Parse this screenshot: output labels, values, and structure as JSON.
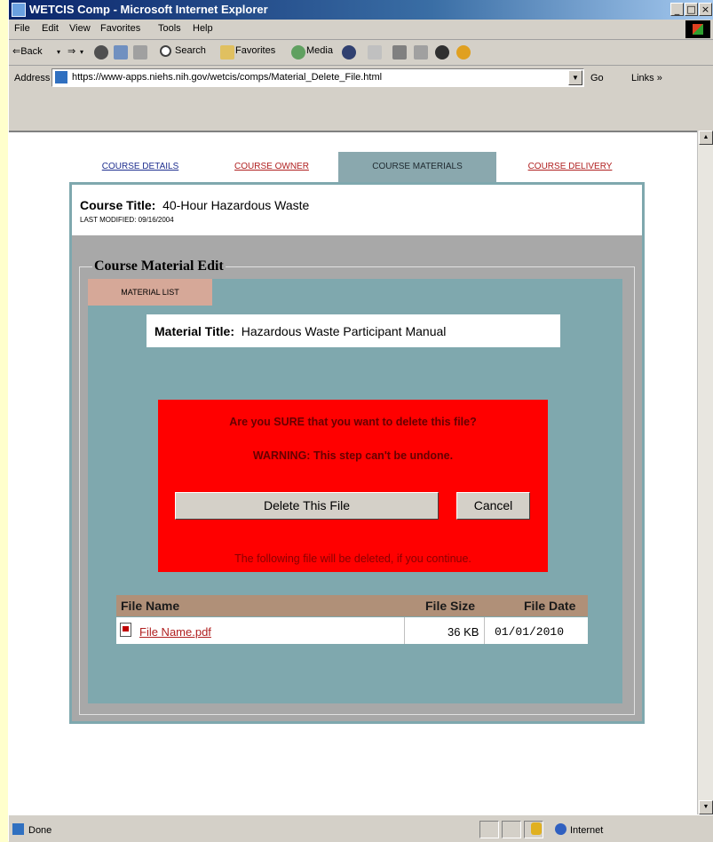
{
  "window": {
    "title": "WETCIS Comp - Microsoft Internet Explorer",
    "minimize": "_",
    "maximize": "□",
    "close": "×"
  },
  "menu": [
    "File",
    "Edit",
    "View",
    "Favorites",
    "Tools",
    "Help"
  ],
  "toolbar": {
    "back": "⇐Back",
    "back_drop": "▾",
    "forward": "⇒",
    "forward_drop": "▾",
    "search": "Search",
    "favorites": "Favorites",
    "media": "Media"
  },
  "address": {
    "label": "Address",
    "url": "https://www-apps.niehs.nih.gov/wetcis/comps/Material_Delete_File.html",
    "go": "Go",
    "links": "Links »"
  },
  "status": {
    "text": "Done",
    "zone": "Internet"
  },
  "tabs": [
    "COURSE DETAILS",
    "COURSE OWNER",
    "COURSE MATERIALS",
    "COURSE DELIVERY"
  ],
  "course": {
    "label": "Course Title:",
    "title": "40-Hour Hazardous Waste",
    "modified": "LAST MODIFIED: 09/16/2004"
  },
  "section": {
    "legend": "Course Material Edit",
    "tab": "MATERIAL LIST"
  },
  "material": {
    "label": "Material Title:",
    "title": "Hazardous Waste Participant Manual"
  },
  "warning": {
    "question": "Are you SURE that you want to delete this file?",
    "caution": "WARNING: This step can't be undone.",
    "delete_button": "Delete This File",
    "cancel_button": "Cancel",
    "notice": "The following file will be deleted, if you continue."
  },
  "file_table": {
    "headers": [
      "File Name",
      "File Size",
      "File Date"
    ],
    "rows": [
      {
        "name": "File Name.pdf",
        "size": "36 KB",
        "date": "01/01/2010"
      }
    ]
  },
  "colors": {
    "tab_active": "#8AA8AE",
    "panel": "#7FA8AE",
    "warning_bg": "#FF0000",
    "table_header": "#B09078",
    "link": "#B02020"
  }
}
